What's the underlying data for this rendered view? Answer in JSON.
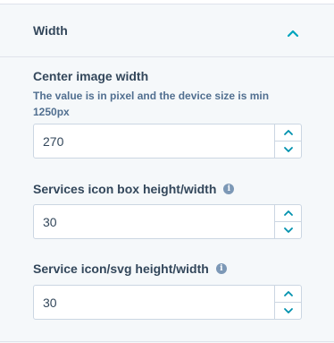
{
  "section": {
    "title": "Width",
    "collapse_icon": "chevron-up-icon",
    "accent_color": "#00a4bd"
  },
  "fields": [
    {
      "label": "Center image width",
      "help": "The value is in pixel and the device size is min 1250px",
      "value": "270",
      "has_info": false
    },
    {
      "label": "Services icon box height/width",
      "value": "30",
      "has_info": true
    },
    {
      "label": "Service icon/svg height/width",
      "value": "30",
      "has_info": true
    }
  ],
  "icons": {
    "info": "info-icon",
    "increment": "chevron-up-icon",
    "decrement": "chevron-down-icon"
  }
}
